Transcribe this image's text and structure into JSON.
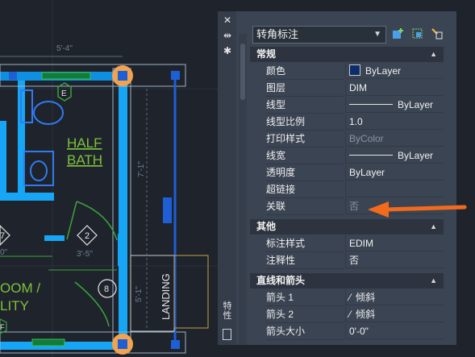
{
  "drawing": {
    "dim_top": "5'-4\"",
    "room_half_bath": [
      "HALF",
      "BATH"
    ],
    "marker_e": "E",
    "marker_2": "2",
    "marker_8": "8",
    "marker_7": "7",
    "marker_f": "F",
    "dim_3_5": "3'-5\"",
    "dim_0": "0\"",
    "room_partial": [
      "OOM /",
      "LITY"
    ],
    "landing": "LANDING",
    "dim_vertical_right": "7'-1\"",
    "dim_vertical_left": "5'-1\""
  },
  "palette": {
    "vertical_title": "特性",
    "selector_value": "转角标注",
    "sections": {
      "general": "常规",
      "misc": "其他",
      "lines_arrows": "直线和箭头"
    },
    "general_rows": [
      {
        "name": "颜色",
        "value": "ByLayer"
      },
      {
        "name": "图层",
        "value": "DIM"
      },
      {
        "name": "线型",
        "value": "ByLayer"
      },
      {
        "name": "线型比例",
        "value": "1.0"
      },
      {
        "name": "打印样式",
        "value": "ByColor"
      },
      {
        "name": "线宽",
        "value": "ByLayer"
      },
      {
        "name": "透明度",
        "value": "ByLayer"
      },
      {
        "name": "超链接",
        "value": ""
      },
      {
        "name": "关联",
        "value": "否"
      }
    ],
    "misc_rows": [
      {
        "name": "标注样式",
        "value": "EDIM"
      },
      {
        "name": "注释性",
        "value": "否"
      }
    ],
    "arrow_rows": [
      {
        "name": "箭头 1",
        "value": "倾斜"
      },
      {
        "name": "箭头 2",
        "value": "倾斜"
      },
      {
        "name": "箭头大小",
        "value": "0'-0\""
      }
    ],
    "colors": {
      "swatch": "#0c2c6b",
      "callout_arrow": "#f26b1d",
      "selection": "#1fb0ff"
    }
  }
}
